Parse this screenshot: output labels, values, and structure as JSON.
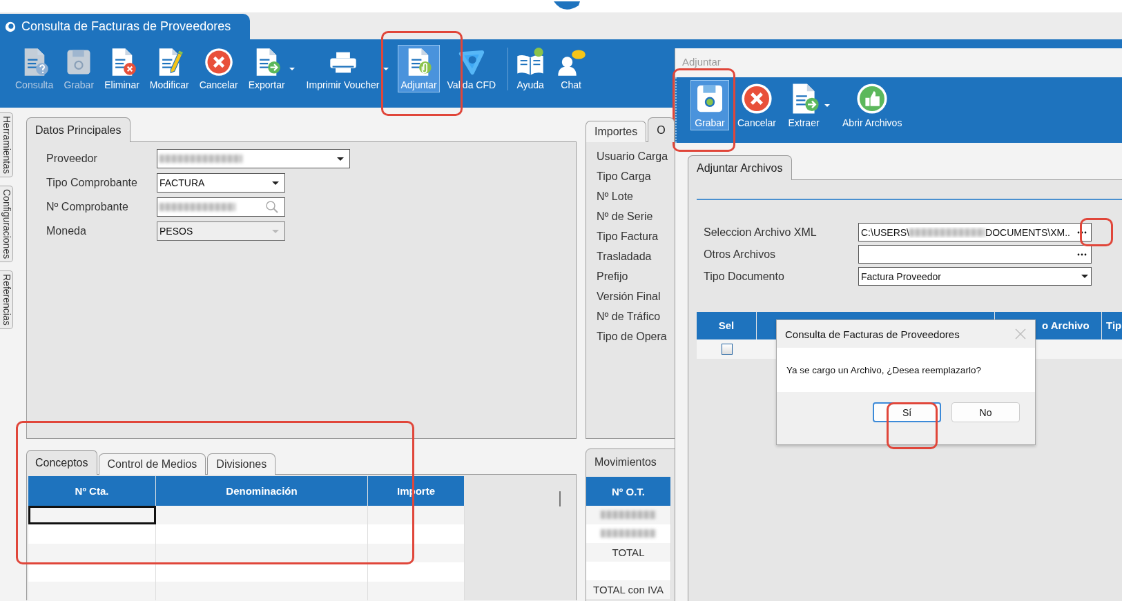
{
  "window": {
    "title": "Consulta de Facturas de Proveedores"
  },
  "toolbar": [
    {
      "label": "Consulta",
      "disabled": true,
      "selected": false,
      "dropdown": false,
      "separator_before": false
    },
    {
      "label": "Grabar",
      "disabled": true,
      "selected": false,
      "dropdown": false,
      "separator_before": false
    },
    {
      "label": "Eliminar",
      "disabled": false,
      "selected": false,
      "dropdown": false,
      "separator_before": false
    },
    {
      "label": "Modificar",
      "disabled": false,
      "selected": false,
      "dropdown": false,
      "separator_before": false
    },
    {
      "label": "Cancelar",
      "disabled": false,
      "selected": false,
      "dropdown": false,
      "separator_before": false
    },
    {
      "label": "Exportar",
      "disabled": false,
      "selected": false,
      "dropdown": true,
      "separator_before": false
    },
    {
      "label": "Imprimir Voucher",
      "disabled": false,
      "selected": false,
      "dropdown": true,
      "separator_before": false
    },
    {
      "label": "Adjuntar",
      "disabled": false,
      "selected": true,
      "dropdown": false,
      "separator_before": false
    },
    {
      "label": "Valida CFD",
      "disabled": false,
      "selected": false,
      "dropdown": false,
      "separator_before": false
    },
    {
      "label": "Ayuda",
      "disabled": false,
      "selected": false,
      "dropdown": false,
      "separator_before": true
    },
    {
      "label": "Chat",
      "disabled": false,
      "selected": false,
      "dropdown": false,
      "separator_before": false
    }
  ],
  "side_tabs": [
    "Herramientas",
    "Configuraciones",
    "Referencias"
  ],
  "main_panel": {
    "tabs": [
      {
        "label": "Datos Principales",
        "selected": true
      }
    ],
    "fields": [
      {
        "label": "Proveedor",
        "kind": "dropdown",
        "redacted": true,
        "disabled": false
      },
      {
        "label": "Tipo Comprobante",
        "kind": "dropdown",
        "value": "FACTURA",
        "redacted": false,
        "disabled": false
      },
      {
        "label": "Nº Comprobante",
        "kind": "search",
        "redacted": true,
        "disabled": false
      },
      {
        "label": "Moneda",
        "kind": "dropdown",
        "value": "PESOS",
        "redacted": false,
        "disabled": true
      }
    ]
  },
  "detail_panel": {
    "tabs": [
      {
        "label": "Importes",
        "selected": false
      },
      {
        "label": "O",
        "selected": true
      }
    ],
    "labels": [
      "Usuario Carga",
      "Tipo Carga",
      "Nº Lote",
      "Nº de Serie",
      "Tipo Factura",
      "Trasladada",
      "Prefijo",
      "Versión Final",
      "Nº de Tráfico",
      "Tipo de Opera"
    ]
  },
  "lines": {
    "tabs": [
      {
        "label": "Conceptos",
        "selected": true
      },
      {
        "label": "Control de Medios",
        "selected": false
      },
      {
        "label": "Divisiones",
        "selected": false
      }
    ],
    "columns": [
      "Nº Cta.",
      "Denominación",
      "Importe"
    ],
    "rows": [
      {
        "focused": true
      },
      {
        "focused": false
      },
      {
        "focused": false
      },
      {
        "focused": false
      },
      {
        "focused": false
      }
    ]
  },
  "movements": {
    "title": "Movimientos",
    "columns": [
      "Nº O.T."
    ],
    "rows": [
      {
        "redacted": true
      },
      {
        "redacted": true
      },
      {
        "redacted": false,
        "text": "TOTAL"
      },
      {
        "redacted": false
      },
      {
        "redacted": false,
        "text": "TOTAL con IVA"
      }
    ]
  },
  "attach_window": {
    "title": "Adjuntar",
    "toolbar": [
      {
        "label": "Grabar",
        "selected": true,
        "dropdown": false
      },
      {
        "label": "Cancelar",
        "selected": false,
        "dropdown": false
      },
      {
        "label": "Extraer",
        "selected": false,
        "dropdown": true
      },
      {
        "label": "Abrir Archivos",
        "selected": false,
        "dropdown": false
      }
    ],
    "tab": {
      "label": "Adjuntar Archivos",
      "selected": true
    },
    "fields": [
      {
        "label": "Seleccion Archivo XML",
        "kind": "browse",
        "value_start": "C:\\USERS\\",
        "redacted": true,
        "value_end": "DOCUMENTS\\XM.."
      },
      {
        "label": "Otros Archivos",
        "kind": "browse",
        "redacted": false
      },
      {
        "label": "Tipo Documento",
        "kind": "dropdown",
        "value": "Factura Proveedor",
        "redacted": false
      }
    ],
    "grid": {
      "columns": [
        "Sel",
        "",
        "o Archivo",
        "Tip"
      ],
      "rows": [
        {
          "checked": false
        }
      ]
    }
  },
  "dialog": {
    "title": "Consulta de Facturas de Proveedores",
    "message": "Ya se cargo un Archivo, ¿Desea reemplazarlo?",
    "buttons": [
      {
        "label": "Sí",
        "default": true
      },
      {
        "label": "No",
        "default": false
      }
    ]
  }
}
